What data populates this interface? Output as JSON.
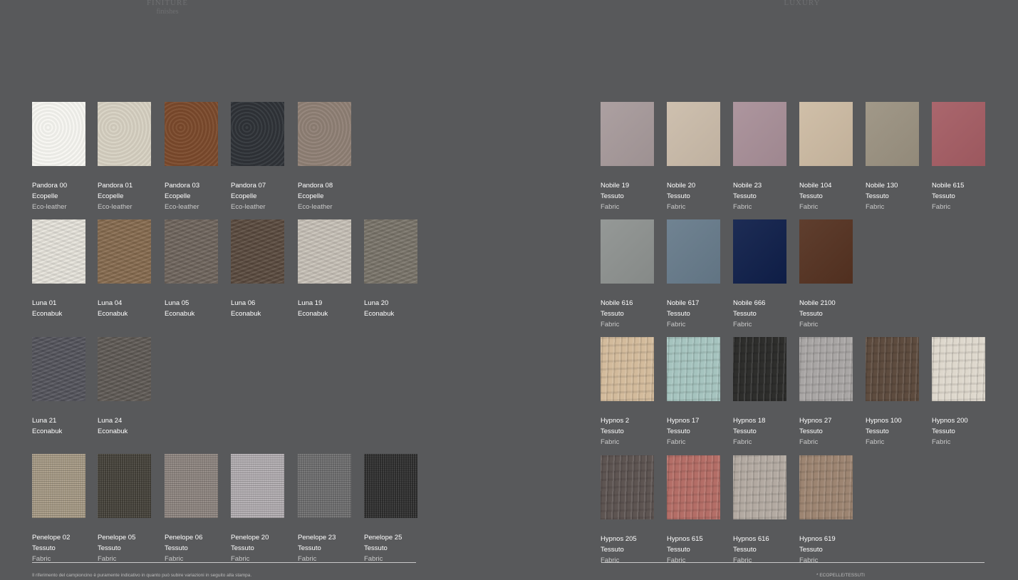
{
  "header": {
    "left_title": "FINITURE",
    "left_subtitle": "finishes",
    "right_title": "LUXURY"
  },
  "left_rows": [
    [
      {
        "name": "Pandora 00",
        "material": "Ecopelle",
        "english": "Eco-leather",
        "color": "#f7f6f1",
        "texture": "leather"
      },
      {
        "name": "Pandora 01",
        "material": "Ecopelle",
        "english": "Eco-leather",
        "color": "#d7d1c2",
        "texture": "leather"
      },
      {
        "name": "Pandora 03",
        "material": "Ecopelle",
        "english": "Eco-leather",
        "color": "#7b4a2c",
        "texture": "leather"
      },
      {
        "name": "Pandora 07",
        "material": "Ecopelle",
        "english": "Eco-leather",
        "color": "#2f3338",
        "texture": "leather"
      },
      {
        "name": "Pandora 08",
        "material": "Ecopelle",
        "english": "Eco-leather",
        "color": "#8f8075",
        "texture": "leather"
      }
    ],
    [
      {
        "name": "Luna 01",
        "material": "Econabuk",
        "color": "#e8e5dd",
        "texture": "buk"
      },
      {
        "name": "Luna 04",
        "material": "Econabuk",
        "color": "#876b4f",
        "texture": "buk"
      },
      {
        "name": "Luna 05",
        "material": "Econabuk",
        "color": "#6f655d",
        "texture": "buk"
      },
      {
        "name": "Luna 06",
        "material": "Econabuk",
        "color": "#5a4a3e",
        "texture": "buk"
      },
      {
        "name": "Luna 19",
        "material": "Econabuk",
        "color": "#c9c3b9",
        "texture": "buk"
      },
      {
        "name": "Luna 20",
        "material": "Econabuk",
        "color": "#7a756a",
        "texture": "buk"
      }
    ],
    [
      {
        "name": "Luna 21",
        "material": "Econabuk",
        "color": "#54545c",
        "texture": "buk"
      },
      {
        "name": "Luna 24",
        "material": "Econabuk",
        "color": "#5f5a55",
        "texture": "buk"
      }
    ],
    [
      {
        "name": "Penelope 02",
        "material": "Tessuto",
        "english": "Fabric",
        "color": "#a69a85",
        "texture": "weave"
      },
      {
        "name": "Penelope 05",
        "material": "Tessuto",
        "english": "Fabric",
        "color": "#45423a",
        "texture": "weave"
      },
      {
        "name": "Penelope 06",
        "material": "Tessuto",
        "english": "Fabric",
        "color": "#8e8580",
        "texture": "weave"
      },
      {
        "name": "Penelope 20",
        "material": "Tessuto",
        "english": "Fabric",
        "color": "#b2adb1",
        "texture": "weave"
      },
      {
        "name": "Penelope 23",
        "material": "Tessuto",
        "english": "Fabric",
        "color": "#6e6e6f",
        "texture": "weave"
      },
      {
        "name": "Penelope 25",
        "material": "Tessuto",
        "english": "Fabric",
        "color": "#2f2f2f",
        "texture": "weave"
      }
    ]
  ],
  "right_rows": [
    [
      {
        "name": "Nobile 19",
        "material": "Tessuto",
        "english": "Fabric",
        "color": "#a79a9b",
        "texture": "velvet"
      },
      {
        "name": "Nobile 20",
        "material": "Tessuto",
        "english": "Fabric",
        "color": "#cbbcaa",
        "texture": "velvet"
      },
      {
        "name": "Nobile 23",
        "material": "Tessuto",
        "english": "Fabric",
        "color": "#a88f98",
        "texture": "velvet"
      },
      {
        "name": "Nobile 104",
        "material": "Tessuto",
        "english": "Fabric",
        "color": "#cdbba3",
        "texture": "velvet"
      },
      {
        "name": "Nobile 130",
        "material": "Tessuto",
        "english": "Fabric",
        "color": "#9b9281",
        "texture": "velvet"
      },
      {
        "name": "Nobile 615",
        "material": "Tessuto",
        "english": "Fabric",
        "color": "#a55d64",
        "texture": "velvet"
      }
    ],
    [
      {
        "name": "Nobile 616",
        "material": "Tessuto",
        "english": "Fabric",
        "color": "#8e9290",
        "texture": "velvet"
      },
      {
        "name": "Nobile 617",
        "material": "Tessuto",
        "english": "Fabric",
        "color": "#677b8b",
        "texture": "velvet"
      },
      {
        "name": "Nobile 666",
        "material": "Tessuto",
        "english": "Fabric",
        "color": "#0f1f4a",
        "texture": "velvet"
      },
      {
        "name": "Nobile 2100",
        "material": "Tessuto",
        "english": "Fabric",
        "color": "#553221",
        "texture": "velvet"
      }
    ],
    [
      {
        "name": "Hypnos 2",
        "material": "Tessuto",
        "english": "Fabric",
        "color": "#d3bb9c",
        "texture": "crush"
      },
      {
        "name": "Hypnos 17",
        "material": "Tessuto",
        "english": "Fabric",
        "color": "#a6c4bf",
        "texture": "crush"
      },
      {
        "name": "Hypnos 18",
        "material": "Tessuto",
        "english": "Fabric",
        "color": "#2e2e2c",
        "texture": "crush"
      },
      {
        "name": "Hypnos 27",
        "material": "Tessuto",
        "english": "Fabric",
        "color": "#a9a6a5",
        "texture": "crush"
      },
      {
        "name": "Hypnos 100",
        "material": "Tessuto",
        "english": "Fabric",
        "color": "#5e4c3f",
        "texture": "crush"
      },
      {
        "name": "Hypnos 200",
        "material": "Tessuto",
        "english": "Fabric",
        "color": "#ded8cd",
        "texture": "crush"
      }
    ],
    [
      {
        "name": "Hypnos 205",
        "material": "Tessuto",
        "english": "Fabric",
        "color": "#5e5552",
        "texture": "crush"
      },
      {
        "name": "Hypnos 615",
        "material": "Tessuto",
        "english": "Fabric",
        "color": "#b46e67",
        "texture": "crush"
      },
      {
        "name": "Hypnos 616",
        "material": "Tessuto",
        "english": "Fabric",
        "color": "#b3aaa2",
        "texture": "crush"
      },
      {
        "name": "Hypnos 619",
        "material": "Tessuto",
        "english": "Fabric",
        "color": "#9d8572",
        "texture": "crush"
      }
    ]
  ],
  "footer": {
    "disclaimer": "Il riferimento del campioncino è puramente indicativo in quanto può subire variazioni in seguito alla stampa.",
    "note": "* ECOPELLE/TESSUTI"
  }
}
